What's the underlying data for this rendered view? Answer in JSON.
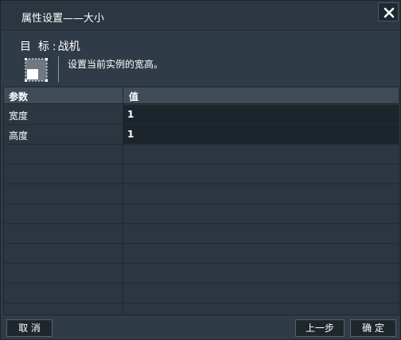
{
  "dialog": {
    "title": "属性设置——大小",
    "target_label": "目  标",
    "target_sep": ":",
    "target_value": "战机",
    "description": "设置当前实例的宽高。"
  },
  "grid": {
    "headers": [
      "参数",
      "值"
    ],
    "rows": [
      {
        "key": "宽度",
        "value": "1"
      },
      {
        "key": "高度",
        "value": "1"
      }
    ]
  },
  "footer": {
    "cancel_label": "取 消",
    "prev_label": "上一步",
    "ok_label": "确 定"
  },
  "icons": {
    "close": "close-icon",
    "size": "resize-icon"
  }
}
